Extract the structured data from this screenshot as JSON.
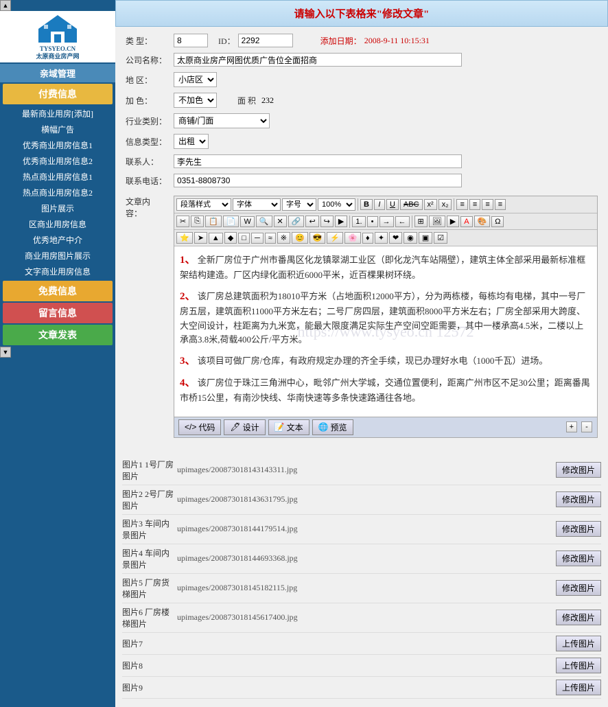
{
  "sidebar": {
    "logo_text": "TYSYEO.CN\n太原商业房产网",
    "sections": [
      {
        "type": "section",
        "label": "亲域管理"
      },
      {
        "type": "highlight",
        "label": "付费信息"
      },
      {
        "type": "item",
        "label": "最新商业用房[添加]"
      },
      {
        "type": "item",
        "label": "横幅广告"
      },
      {
        "type": "item",
        "label": "优秀商业用房信息1"
      },
      {
        "type": "item",
        "label": "优秀商业用房信息2"
      },
      {
        "type": "item",
        "label": "热点商业用房信息1"
      },
      {
        "type": "item",
        "label": "热点商业用房信息2"
      },
      {
        "type": "item",
        "label": "图片展示"
      },
      {
        "type": "item",
        "label": "区商业用房信息"
      },
      {
        "type": "item",
        "label": "优秀地产中介"
      },
      {
        "type": "item",
        "label": "商业用房图片展示"
      },
      {
        "type": "item",
        "label": "文字商业用房信息"
      },
      {
        "type": "highlight2",
        "label": "免费信息"
      },
      {
        "type": "highlight3",
        "label": "留言信息"
      },
      {
        "type": "green",
        "label": "文章发表"
      }
    ]
  },
  "header": {
    "prefix": "请输入以下表格来",
    "highlight": "修改文章",
    "suffix": ""
  },
  "form": {
    "type_label": "类  型：",
    "type_value": "8",
    "id_label": "ID：",
    "id_value": "2292",
    "date_label": "添加日期：",
    "date_value": "2008-9-11  10:15:31",
    "company_label": "公司名称：",
    "company_value": "太原商业房产网图优质广告位全面招商",
    "district_label": "地    区：",
    "district_value": "小店区",
    "color_label": "加    色：",
    "color_value": "不加色",
    "area_label": "面    积",
    "area_value": "232",
    "industry_label": "行业类别：",
    "industry_value": "商铺/门面",
    "info_type_label": "信息类型：",
    "info_type_value": "出租",
    "contact_label": "联系人：",
    "contact_value": "李先生",
    "phone_label": "联系电话：",
    "phone_value": "0351-8808730",
    "content_label": "文章内\n容："
  },
  "toolbar": {
    "style_options": [
      "段落样式"
    ],
    "font_options": [
      "字体"
    ],
    "size_options": [
      "字号"
    ],
    "zoom_value": "100%",
    "bold": "B",
    "italic": "I",
    "underline": "U"
  },
  "editor_content": {
    "watermark": "https://www.tysyeo.cn 12572",
    "paragraphs": [
      {
        "num": "1、",
        "text": "全新厂房位于广州市番禺区化龙镇翠湖工业区（即化龙汽车站隔壁），建筑主体全部采用最新标准框架结构建造。厂区内绿化面积近6000平米，近百棵果树环绕。"
      },
      {
        "num": "2、",
        "text": "该厂房总建筑面积为18010平米（占地面积12000平方），分为两栋楼，每栋均有电梯，其中一号厂房五层，建筑面积11000平方米左右；二号厂房四层，建筑面积8000平方米左右；厂房全部采用大跨度、大空间设计，柱距离为九米宽，能最大限度满足实际生产空间空距需要，其中一楼承高4.5米，二楼以上承高3.8米,荷载400公斤/平方米。"
      },
      {
        "num": "3、",
        "text": "该项目可做厂房/仓库，有政府规定办理的齐全手续，现已办理好水电（1000千瓦）进场。"
      },
      {
        "num": "4、",
        "text": "该厂房位于珠江三角洲中心，毗邻广州大学城，交通位置便利，距离广州市区不足30公里；距离番禺市桥15公里，有南沙快线、华南快速等多条快速路通往各地。"
      }
    ]
  },
  "bottom_tabs": {
    "code_label": "代码",
    "design_label": "设计",
    "text_label": "文本",
    "preview_label": "预览"
  },
  "images": [
    {
      "label": "图片1",
      "desc": "1号厂房图片",
      "path": "upimages/200873018143143311.jpg",
      "btn": "修改图片"
    },
    {
      "label": "图片2",
      "desc": "2号厂房图片",
      "path": "upimages/200873018143631795.jpg",
      "btn": "修改图片"
    },
    {
      "label": "图片3",
      "desc": "车间内景图片",
      "path": "upimages/200873018144179514.jpg",
      "btn": "修改图片"
    },
    {
      "label": "图片4",
      "desc": "车间内景图片",
      "path": "upimages/200873018144693368.jpg",
      "btn": "修改图片"
    },
    {
      "label": "图片5",
      "desc": "厂房货梯图片",
      "path": "upimages/200873018145182115.jpg",
      "btn": "修改图片"
    },
    {
      "label": "图片6",
      "desc": "厂房楼梯图片",
      "path": "upimages/200873018145617400.jpg",
      "btn": "修改图片"
    },
    {
      "label": "图片7",
      "desc": "",
      "path": "",
      "btn": "上传图片"
    },
    {
      "label": "图片8",
      "desc": "",
      "path": "",
      "btn": "上传图片"
    },
    {
      "label": "图片9",
      "desc": "",
      "path": "",
      "btn": "上传图片"
    }
  ]
}
